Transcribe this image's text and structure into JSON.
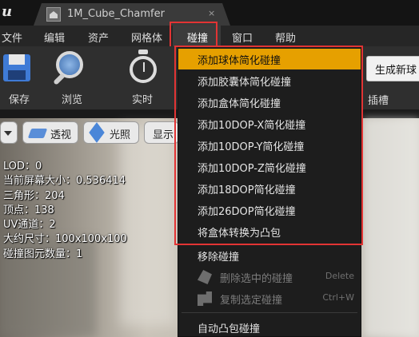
{
  "titlebar": {
    "logo": "u",
    "tab_title": "1M_Cube_Chamfer",
    "tab_close": "×"
  },
  "menubar": {
    "items": [
      "文件",
      "编辑",
      "资产",
      "网格体",
      "碰撞",
      "窗口",
      "帮助"
    ],
    "active_index": 4
  },
  "toolbar": {
    "buttons": [
      {
        "label": "保存",
        "icon": "save-icon"
      },
      {
        "label": "浏览",
        "icon": "browse-icon"
      },
      {
        "label": "实时",
        "icon": "realtime-icon"
      }
    ],
    "right_button_label": "生成新球",
    "slot_label": "插槽"
  },
  "viewport_options": {
    "perspective_label": "透视",
    "lit_label": "光照",
    "show_label": "显示"
  },
  "stats": {
    "lines": [
      "LOD：0",
      "当前屏幕大小：0.536414",
      "三角形：204",
      "顶点：138",
      "UV通道：2",
      "大约尺寸：100x100x100",
      "碰撞图元数量：1"
    ]
  },
  "dropdown": {
    "items": [
      {
        "label": "添加球体简化碰撞",
        "highlighted": true
      },
      {
        "label": "添加胶囊体简化碰撞"
      },
      {
        "label": "添加盒体简化碰撞"
      },
      {
        "label": "添加10DOP-X简化碰撞"
      },
      {
        "label": "添加10DOP-Y简化碰撞"
      },
      {
        "label": "添加10DOP-Z简化碰撞"
      },
      {
        "label": "添加18DOP简化碰撞"
      },
      {
        "label": "添加26DOP简化碰撞"
      },
      {
        "label": "将盒体转换为凸包"
      },
      {
        "label": "移除碰撞"
      },
      {
        "label": "删除选中的碰撞",
        "shortcut": "Delete",
        "disabled": true,
        "icon": "delete-icon"
      },
      {
        "label": "复制选定碰撞",
        "shortcut": "Ctrl+W",
        "disabled": true,
        "icon": "copy-icon"
      },
      {
        "label": "自动凸包碰撞"
      }
    ]
  },
  "colors": {
    "highlight": "#e6a000",
    "annotation_red": "#e23434",
    "menu_bg": "#1d1d1d"
  }
}
